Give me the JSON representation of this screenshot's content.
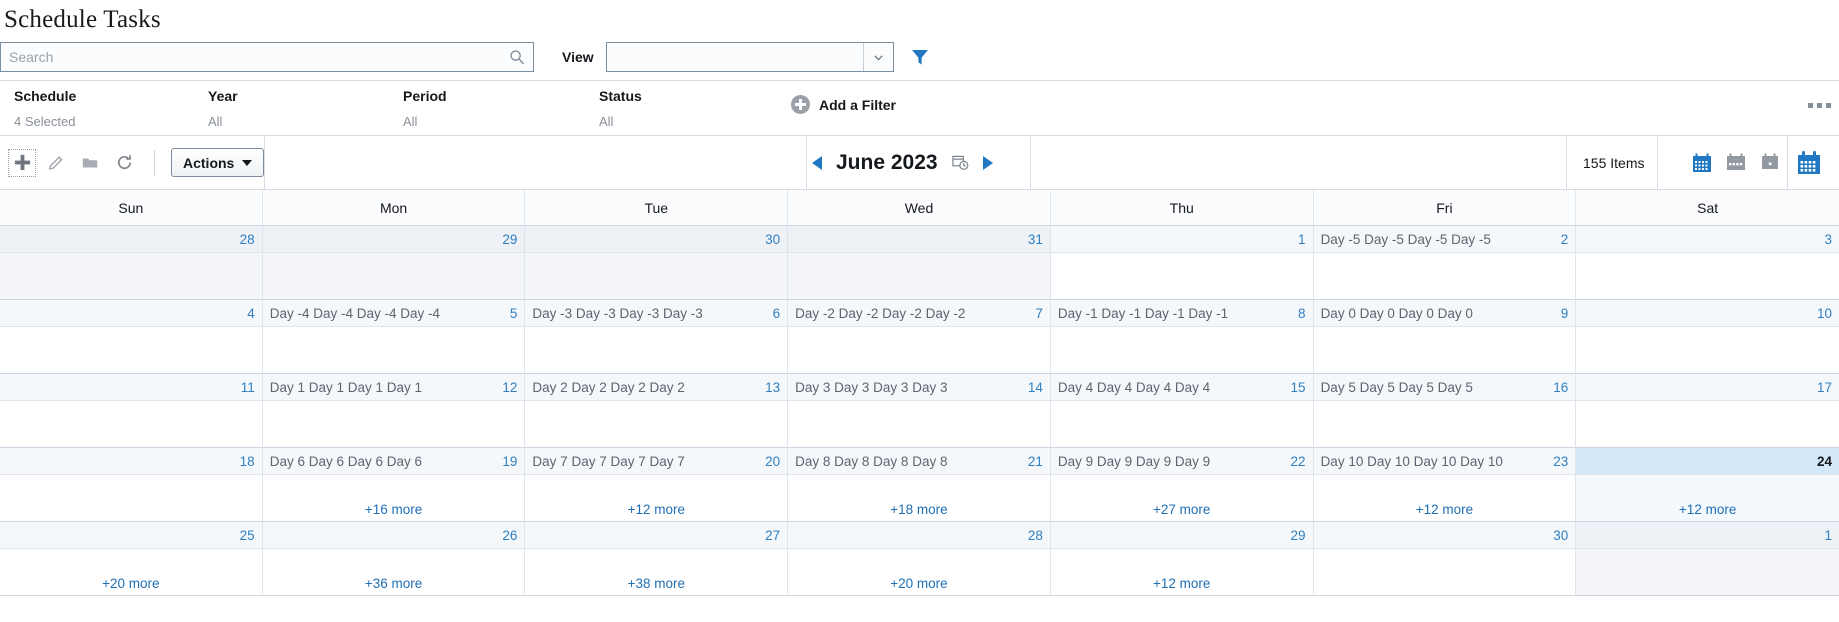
{
  "page": {
    "title": "Schedule Tasks"
  },
  "search": {
    "placeholder": "Search",
    "value": "",
    "icon": "search-icon"
  },
  "view": {
    "label": "View",
    "value": "",
    "caret_icon": "chevron-down-icon",
    "filter_icon": "funnel-icon"
  },
  "filters": {
    "columns": [
      {
        "name": "Schedule",
        "value": "4 Selected"
      },
      {
        "name": "Year",
        "value": "All"
      },
      {
        "name": "Period",
        "value": "All"
      },
      {
        "name": "Status",
        "value": "All"
      }
    ],
    "add_filter_label": "Add a Filter",
    "add_filter_icon": "plus-circle-icon",
    "overflow_icon": "ellipsis-icon"
  },
  "toolbar": {
    "icons": [
      {
        "name": "add-icon",
        "glyph": "+"
      },
      {
        "name": "edit-pencil-icon",
        "glyph": "pencil"
      },
      {
        "name": "folder-icon",
        "glyph": "folder"
      },
      {
        "name": "refresh-icon",
        "glyph": "refresh"
      }
    ],
    "actions_label": "Actions",
    "prev_icon": "prev-arrow-icon",
    "next_icon": "next-arrow-icon",
    "month_label": "June 2023",
    "date_picker_icon": "calendar-clock-icon",
    "items_count": "155 Items",
    "view_icons": [
      {
        "name": "month-view-icon",
        "active": true
      },
      {
        "name": "week-view-icon",
        "active": false
      },
      {
        "name": "day-view-icon",
        "active": false
      },
      {
        "name": "calendar-jump-icon",
        "active": true
      }
    ]
  },
  "calendar": {
    "day_headers": [
      "Sun",
      "Mon",
      "Tue",
      "Wed",
      "Thu",
      "Fri",
      "Sat"
    ],
    "weeks": [
      [
        {
          "num": "28",
          "event": "",
          "more": "",
          "out": true
        },
        {
          "num": "29",
          "event": "",
          "more": "",
          "out": true
        },
        {
          "num": "30",
          "event": "",
          "more": "",
          "out": true
        },
        {
          "num": "31",
          "event": "",
          "more": "",
          "out": true
        },
        {
          "num": "1",
          "event": "",
          "more": "",
          "out": false
        },
        {
          "num": "2",
          "event": "Day -5 Day -5 Day -5 Day -5",
          "more": "",
          "out": false
        },
        {
          "num": "3",
          "event": "",
          "more": "",
          "out": false
        }
      ],
      [
        {
          "num": "4",
          "event": "",
          "more": "",
          "out": false
        },
        {
          "num": "5",
          "event": "Day -4 Day -4 Day -4 Day -4",
          "more": "",
          "out": false
        },
        {
          "num": "6",
          "event": "Day -3 Day -3 Day -3 Day -3",
          "more": "",
          "out": false
        },
        {
          "num": "7",
          "event": "Day -2 Day -2 Day -2 Day -2",
          "more": "",
          "out": false
        },
        {
          "num": "8",
          "event": "Day -1 Day -1 Day -1 Day -1",
          "more": "",
          "out": false
        },
        {
          "num": "9",
          "event": "Day 0 Day 0 Day 0 Day 0",
          "more": "",
          "out": false
        },
        {
          "num": "10",
          "event": "",
          "more": "",
          "out": false
        }
      ],
      [
        {
          "num": "11",
          "event": "",
          "more": "",
          "out": false
        },
        {
          "num": "12",
          "event": "Day 1 Day 1 Day 1 Day 1",
          "more": "",
          "out": false
        },
        {
          "num": "13",
          "event": "Day 2 Day 2 Day 2 Day 2",
          "more": "",
          "out": false
        },
        {
          "num": "14",
          "event": "Day 3 Day 3 Day 3 Day 3",
          "more": "",
          "out": false
        },
        {
          "num": "15",
          "event": "Day 4 Day 4 Day 4 Day 4",
          "more": "",
          "out": false
        },
        {
          "num": "16",
          "event": "Day 5 Day 5 Day 5 Day 5",
          "more": "",
          "out": false
        },
        {
          "num": "17",
          "event": "",
          "more": "",
          "out": false
        }
      ],
      [
        {
          "num": "18",
          "event": "",
          "more": "",
          "out": false
        },
        {
          "num": "19",
          "event": "Day 6 Day 6 Day 6 Day 6",
          "more": "+16 more",
          "out": false
        },
        {
          "num": "20",
          "event": "Day 7 Day 7 Day 7 Day 7",
          "more": "+12 more",
          "out": false
        },
        {
          "num": "21",
          "event": "Day 8 Day 8 Day 8 Day 8",
          "more": "+18 more",
          "out": false
        },
        {
          "num": "22",
          "event": "Day 9 Day 9 Day 9 Day 9",
          "more": "+27 more",
          "out": false
        },
        {
          "num": "23",
          "event": "Day 10 Day 10 Day 10 Day 10",
          "more": "+12 more",
          "out": false
        },
        {
          "num": "24",
          "event": "",
          "more": "+12 more",
          "out": false,
          "selected": true
        }
      ],
      [
        {
          "num": "25",
          "event": "",
          "more": "+20 more",
          "out": false
        },
        {
          "num": "26",
          "event": "",
          "more": "+36 more",
          "out": false
        },
        {
          "num": "27",
          "event": "",
          "more": "+38 more",
          "out": false
        },
        {
          "num": "28",
          "event": "",
          "more": "+20 more",
          "out": false
        },
        {
          "num": "29",
          "event": "",
          "more": "+12 more",
          "out": false
        },
        {
          "num": "30",
          "event": "",
          "more": "",
          "out": false
        },
        {
          "num": "1",
          "event": "",
          "more": "",
          "out": true
        }
      ]
    ]
  },
  "colors": {
    "accent": "#1f78c1",
    "link": "#1f6fb5",
    "selected_bg": "#d3e8f8"
  }
}
